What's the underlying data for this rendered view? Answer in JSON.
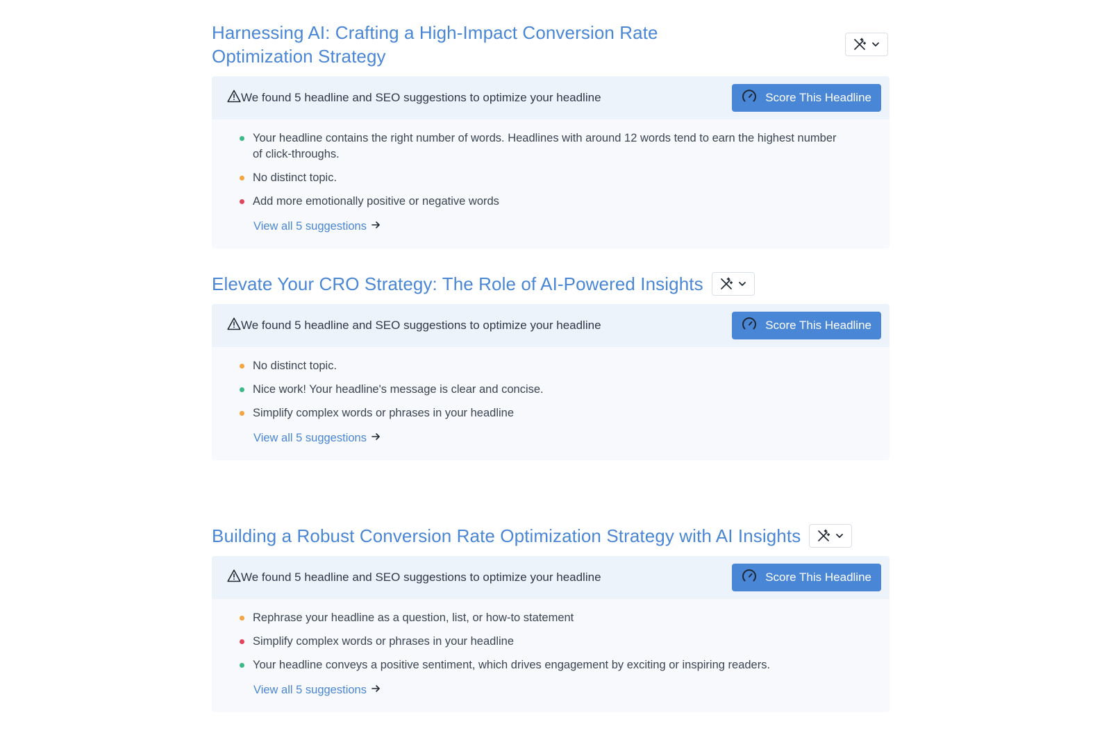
{
  "colors": {
    "accent": "#4a86d6",
    "status_good": "#3fb888",
    "status_warn": "#f2a541",
    "status_bad": "#e0455b"
  },
  "headlines": [
    {
      "title": "Harnessing AI: Crafting a High-Impact Conversion Rate Optimization Strategy",
      "alert": "We found 5 headline and SEO suggestions to optimize your headline",
      "score_label": "Score This Headline",
      "suggestions": [
        {
          "status": "good",
          "text": "Your headline contains the right number of words. Headlines with around 12 words tend to earn the highest number of click-throughs."
        },
        {
          "status": "warn",
          "text": "No distinct topic."
        },
        {
          "status": "bad",
          "text": "Add more emotionally positive or negative words"
        }
      ],
      "view_all": "View all 5 suggestions"
    },
    {
      "title": "Elevate Your CRO Strategy: The Role of AI-Powered Insights",
      "alert": "We found 5 headline and SEO suggestions to optimize your headline",
      "score_label": "Score This Headline",
      "suggestions": [
        {
          "status": "warn",
          "text": "No distinct topic."
        },
        {
          "status": "good",
          "text": "Nice work! Your headline's message is clear and concise."
        },
        {
          "status": "warn",
          "text": "Simplify complex words or phrases in your headline"
        }
      ],
      "view_all": "View all 5 suggestions"
    },
    {
      "title": "Building a Robust Conversion Rate Optimization Strategy with AI Insights",
      "alert": "We found 5 headline and SEO suggestions to optimize your headline",
      "score_label": "Score This Headline",
      "suggestions": [
        {
          "status": "warn",
          "text": "Rephrase your headline as a question, list, or how-to statement"
        },
        {
          "status": "bad",
          "text": "Simplify complex words or phrases in your headline"
        },
        {
          "status": "good",
          "text": "Your headline conveys a positive sentiment, which drives engagement by exciting or inspiring readers."
        }
      ],
      "view_all": "View all 5 suggestions"
    }
  ]
}
